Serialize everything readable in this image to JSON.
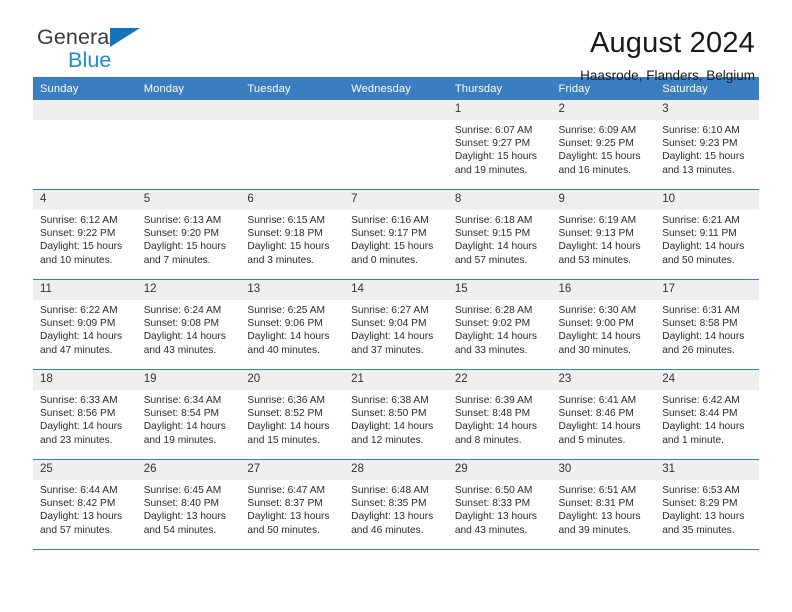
{
  "brand": {
    "line1": "General",
    "line2": "Blue",
    "triangle_color": "#1274bd",
    "blue_text_color": "#1f8ad6"
  },
  "header": {
    "title": "August 2024",
    "subtitle": "Haasrode, Flanders, Belgium",
    "header_bg": "#3b7dc1",
    "daynum_bg": "#efefef"
  },
  "weekdays": [
    "Sunday",
    "Monday",
    "Tuesday",
    "Wednesday",
    "Thursday",
    "Friday",
    "Saturday"
  ],
  "labels": {
    "sunrise": "Sunrise:",
    "sunset": "Sunset:",
    "daylight": "Daylight:"
  },
  "weeks": [
    [
      {
        "day": "",
        "blank": true
      },
      {
        "day": "",
        "blank": true
      },
      {
        "day": "",
        "blank": true
      },
      {
        "day": "",
        "blank": true
      },
      {
        "day": "1",
        "sunrise": "Sunrise: 6:07 AM",
        "sunset": "Sunset: 9:27 PM",
        "daylight": "Daylight: 15 hours and 19 minutes."
      },
      {
        "day": "2",
        "sunrise": "Sunrise: 6:09 AM",
        "sunset": "Sunset: 9:25 PM",
        "daylight": "Daylight: 15 hours and 16 minutes."
      },
      {
        "day": "3",
        "sunrise": "Sunrise: 6:10 AM",
        "sunset": "Sunset: 9:23 PM",
        "daylight": "Daylight: 15 hours and 13 minutes."
      }
    ],
    [
      {
        "day": "4",
        "sunrise": "Sunrise: 6:12 AM",
        "sunset": "Sunset: 9:22 PM",
        "daylight": "Daylight: 15 hours and 10 minutes."
      },
      {
        "day": "5",
        "sunrise": "Sunrise: 6:13 AM",
        "sunset": "Sunset: 9:20 PM",
        "daylight": "Daylight: 15 hours and 7 minutes."
      },
      {
        "day": "6",
        "sunrise": "Sunrise: 6:15 AM",
        "sunset": "Sunset: 9:18 PM",
        "daylight": "Daylight: 15 hours and 3 minutes."
      },
      {
        "day": "7",
        "sunrise": "Sunrise: 6:16 AM",
        "sunset": "Sunset: 9:17 PM",
        "daylight": "Daylight: 15 hours and 0 minutes."
      },
      {
        "day": "8",
        "sunrise": "Sunrise: 6:18 AM",
        "sunset": "Sunset: 9:15 PM",
        "daylight": "Daylight: 14 hours and 57 minutes."
      },
      {
        "day": "9",
        "sunrise": "Sunrise: 6:19 AM",
        "sunset": "Sunset: 9:13 PM",
        "daylight": "Daylight: 14 hours and 53 minutes."
      },
      {
        "day": "10",
        "sunrise": "Sunrise: 6:21 AM",
        "sunset": "Sunset: 9:11 PM",
        "daylight": "Daylight: 14 hours and 50 minutes."
      }
    ],
    [
      {
        "day": "11",
        "sunrise": "Sunrise: 6:22 AM",
        "sunset": "Sunset: 9:09 PM",
        "daylight": "Daylight: 14 hours and 47 minutes."
      },
      {
        "day": "12",
        "sunrise": "Sunrise: 6:24 AM",
        "sunset": "Sunset: 9:08 PM",
        "daylight": "Daylight: 14 hours and 43 minutes."
      },
      {
        "day": "13",
        "sunrise": "Sunrise: 6:25 AM",
        "sunset": "Sunset: 9:06 PM",
        "daylight": "Daylight: 14 hours and 40 minutes."
      },
      {
        "day": "14",
        "sunrise": "Sunrise: 6:27 AM",
        "sunset": "Sunset: 9:04 PM",
        "daylight": "Daylight: 14 hours and 37 minutes."
      },
      {
        "day": "15",
        "sunrise": "Sunrise: 6:28 AM",
        "sunset": "Sunset: 9:02 PM",
        "daylight": "Daylight: 14 hours and 33 minutes."
      },
      {
        "day": "16",
        "sunrise": "Sunrise: 6:30 AM",
        "sunset": "Sunset: 9:00 PM",
        "daylight": "Daylight: 14 hours and 30 minutes."
      },
      {
        "day": "17",
        "sunrise": "Sunrise: 6:31 AM",
        "sunset": "Sunset: 8:58 PM",
        "daylight": "Daylight: 14 hours and 26 minutes."
      }
    ],
    [
      {
        "day": "18",
        "sunrise": "Sunrise: 6:33 AM",
        "sunset": "Sunset: 8:56 PM",
        "daylight": "Daylight: 14 hours and 23 minutes."
      },
      {
        "day": "19",
        "sunrise": "Sunrise: 6:34 AM",
        "sunset": "Sunset: 8:54 PM",
        "daylight": "Daylight: 14 hours and 19 minutes."
      },
      {
        "day": "20",
        "sunrise": "Sunrise: 6:36 AM",
        "sunset": "Sunset: 8:52 PM",
        "daylight": "Daylight: 14 hours and 15 minutes."
      },
      {
        "day": "21",
        "sunrise": "Sunrise: 6:38 AM",
        "sunset": "Sunset: 8:50 PM",
        "daylight": "Daylight: 14 hours and 12 minutes."
      },
      {
        "day": "22",
        "sunrise": "Sunrise: 6:39 AM",
        "sunset": "Sunset: 8:48 PM",
        "daylight": "Daylight: 14 hours and 8 minutes."
      },
      {
        "day": "23",
        "sunrise": "Sunrise: 6:41 AM",
        "sunset": "Sunset: 8:46 PM",
        "daylight": "Daylight: 14 hours and 5 minutes."
      },
      {
        "day": "24",
        "sunrise": "Sunrise: 6:42 AM",
        "sunset": "Sunset: 8:44 PM",
        "daylight": "Daylight: 14 hours and 1 minute."
      }
    ],
    [
      {
        "day": "25",
        "sunrise": "Sunrise: 6:44 AM",
        "sunset": "Sunset: 8:42 PM",
        "daylight": "Daylight: 13 hours and 57 minutes."
      },
      {
        "day": "26",
        "sunrise": "Sunrise: 6:45 AM",
        "sunset": "Sunset: 8:40 PM",
        "daylight": "Daylight: 13 hours and 54 minutes."
      },
      {
        "day": "27",
        "sunrise": "Sunrise: 6:47 AM",
        "sunset": "Sunset: 8:37 PM",
        "daylight": "Daylight: 13 hours and 50 minutes."
      },
      {
        "day": "28",
        "sunrise": "Sunrise: 6:48 AM",
        "sunset": "Sunset: 8:35 PM",
        "daylight": "Daylight: 13 hours and 46 minutes."
      },
      {
        "day": "29",
        "sunrise": "Sunrise: 6:50 AM",
        "sunset": "Sunset: 8:33 PM",
        "daylight": "Daylight: 13 hours and 43 minutes."
      },
      {
        "day": "30",
        "sunrise": "Sunrise: 6:51 AM",
        "sunset": "Sunset: 8:31 PM",
        "daylight": "Daylight: 13 hours and 39 minutes."
      },
      {
        "day": "31",
        "sunrise": "Sunrise: 6:53 AM",
        "sunset": "Sunset: 8:29 PM",
        "daylight": "Daylight: 13 hours and 35 minutes."
      }
    ]
  ]
}
